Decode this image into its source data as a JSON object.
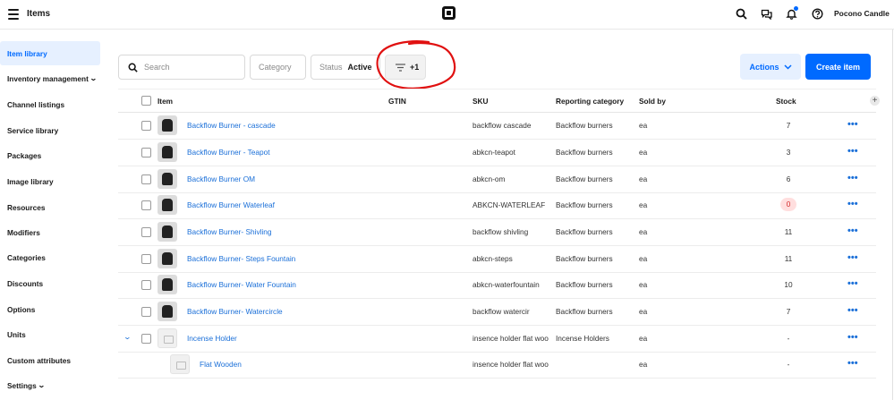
{
  "header": {
    "title": "Items",
    "store_name": "Pocono Candle",
    "icons": [
      "menu-icon",
      "square-logo-icon",
      "search-icon",
      "chat-icon",
      "bell-icon",
      "help-icon"
    ]
  },
  "sidebar": {
    "items": [
      {
        "label": "Item library",
        "active": true
      },
      {
        "label": "Inventory management",
        "chevron": true
      },
      {
        "label": "Channel listings"
      },
      {
        "label": "Service library"
      },
      {
        "label": "Packages"
      },
      {
        "label": "Image library"
      },
      {
        "label": "Resources"
      },
      {
        "label": "Modifiers"
      },
      {
        "label": "Categories"
      },
      {
        "label": "Discounts"
      },
      {
        "label": "Options"
      },
      {
        "label": "Units"
      },
      {
        "label": "Custom attributes"
      },
      {
        "label": "Settings",
        "chevron": true
      }
    ]
  },
  "filters": {
    "search_placeholder": "Search",
    "category_label": "Category",
    "status_label": "Status",
    "status_value": "Active",
    "filter_count": "+1"
  },
  "buttons": {
    "actions_label": "Actions",
    "create_label": "Create item"
  },
  "table": {
    "columns": {
      "item": "Item",
      "gtin": "GTIN",
      "sku": "SKU",
      "reporting_category": "Reporting category",
      "sold_by": "Sold by",
      "stock": "Stock"
    },
    "rows": [
      {
        "name": "Backflow Burner - cascade",
        "gtin": "",
        "sku": "backflow cascade",
        "category": "Backflow burners",
        "sold_by": "ea",
        "stock": "7"
      },
      {
        "name": "Backflow Burner - Teapot",
        "gtin": "",
        "sku": "abkcn-teapot",
        "category": "Backflow burners",
        "sold_by": "ea",
        "stock": "3"
      },
      {
        "name": "Backflow Burner OM",
        "gtin": "",
        "sku": "abkcn-om",
        "category": "Backflow burners",
        "sold_by": "ea",
        "stock": "6"
      },
      {
        "name": "Backflow Burner Waterleaf",
        "gtin": "",
        "sku": "ABKCN-WATERLEAF",
        "category": "Backflow burners",
        "sold_by": "ea",
        "stock": "0",
        "stock_alert": true
      },
      {
        "name": "Backflow Burner- Shivling",
        "gtin": "",
        "sku": "backflow shivling",
        "category": "Backflow burners",
        "sold_by": "ea",
        "stock": "11"
      },
      {
        "name": "Backflow Burner- Steps Fountain",
        "gtin": "",
        "sku": "abkcn-steps",
        "category": "Backflow burners",
        "sold_by": "ea",
        "stock": "11"
      },
      {
        "name": "Backflow Burner- Water Fountain",
        "gtin": "",
        "sku": "abkcn-waterfountain",
        "category": "Backflow burners",
        "sold_by": "ea",
        "stock": "10"
      },
      {
        "name": "Backflow Burner- Watercircle",
        "gtin": "",
        "sku": "backflow watercir",
        "category": "Backflow burners",
        "sold_by": "ea",
        "stock": "7"
      },
      {
        "name": "Incense Holder",
        "gtin": "",
        "sku": "insence holder flat woo",
        "category": "Incense Holders",
        "sold_by": "ea",
        "stock": "-",
        "expandable": true,
        "no_image": true
      },
      {
        "name": "Flat Wooden",
        "gtin": "",
        "sku": "insence holder flat woo",
        "category": "",
        "sold_by": "ea",
        "stock": "-",
        "variant": true,
        "no_image": true
      }
    ]
  },
  "colors": {
    "accent": "#006aff",
    "link": "#1a6fd8",
    "stock_alert_bg": "#ffdede",
    "stock_alert_text": "#d42c2c",
    "annotation": "#e01010"
  }
}
